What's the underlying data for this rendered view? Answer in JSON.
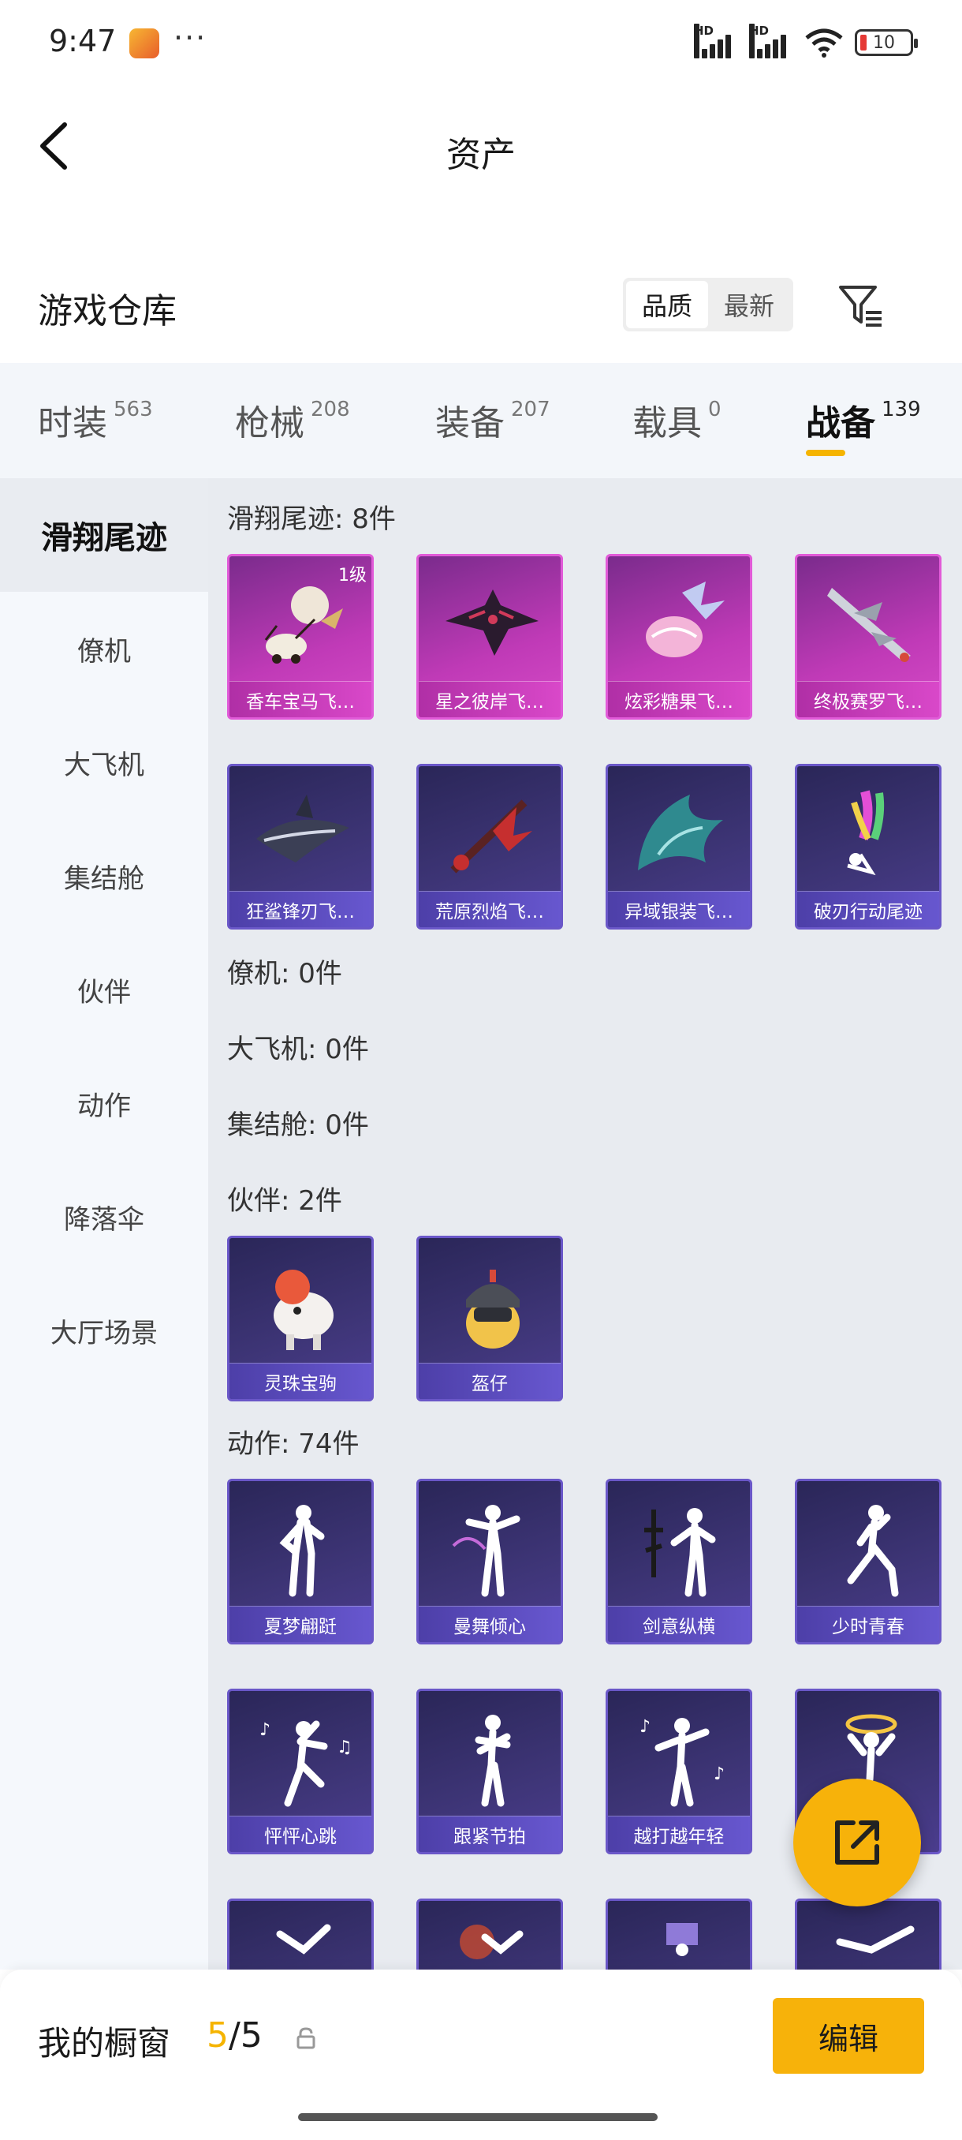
{
  "status_bar": {
    "time": "9:47",
    "dots": "···",
    "battery": "10",
    "hd1": "HD",
    "hd2": "HD"
  },
  "header": {
    "title": "资产"
  },
  "warehouse": {
    "title": "游戏仓库",
    "sort_options": [
      "品质",
      "最新"
    ],
    "active_sort": "品质"
  },
  "tabs": [
    {
      "label": "时装",
      "count": "563"
    },
    {
      "label": "枪械",
      "count": "208"
    },
    {
      "label": "装备",
      "count": "207"
    },
    {
      "label": "载具",
      "count": "0"
    },
    {
      "label": "战备",
      "count": "139"
    }
  ],
  "active_tab": "战备",
  "sidebar": {
    "items": [
      "滑翔尾迹",
      "僚机",
      "大飞机",
      "集结舱",
      "伙伴",
      "动作",
      "降落伞",
      "大厅场景"
    ],
    "active": "滑翔尾迹"
  },
  "sections": {
    "glide": {
      "title": "滑翔尾迹: 8件"
    },
    "wingman": {
      "title": "僚机: 0件"
    },
    "big_plane": {
      "title": "大飞机: 0件"
    },
    "rally_pod": {
      "title": "集结舱: 0件"
    },
    "partner": {
      "title": "伙伴: 2件"
    },
    "emote": {
      "title": "动作: 74件"
    }
  },
  "glide_items": [
    {
      "name": "香车宝马飞…",
      "level": "1级",
      "rarity": "purple"
    },
    {
      "name": "星之彼岸飞…",
      "rarity": "purple"
    },
    {
      "name": "炫彩糖果飞…",
      "rarity": "purple"
    },
    {
      "name": "终极赛罗飞…",
      "rarity": "purple"
    },
    {
      "name": "狂鲨锋刃飞…",
      "rarity": "navy"
    },
    {
      "name": "荒原烈焰飞…",
      "rarity": "navy"
    },
    {
      "name": "异域银装飞…",
      "rarity": "navy"
    },
    {
      "name": "破刃行动尾迹",
      "rarity": "navy"
    }
  ],
  "partner_items": [
    {
      "name": "灵珠宝驹"
    },
    {
      "name": "盔仔"
    }
  ],
  "emote_items": [
    {
      "name": "夏梦翩跹"
    },
    {
      "name": "曼舞倾心"
    },
    {
      "name": "剑意纵横"
    },
    {
      "name": "少时青春"
    },
    {
      "name": "怦怦心跳"
    },
    {
      "name": "跟紧节拍"
    },
    {
      "name": "越打越年轻"
    }
  ],
  "bottom": {
    "label": "我的橱窗",
    "current": "5",
    "sep": "/",
    "total": "5",
    "edit": "编辑"
  },
  "colors": {
    "accent": "#f7b20a",
    "purple_card": "#c03ab7",
    "navy_card": "#3e3577"
  }
}
